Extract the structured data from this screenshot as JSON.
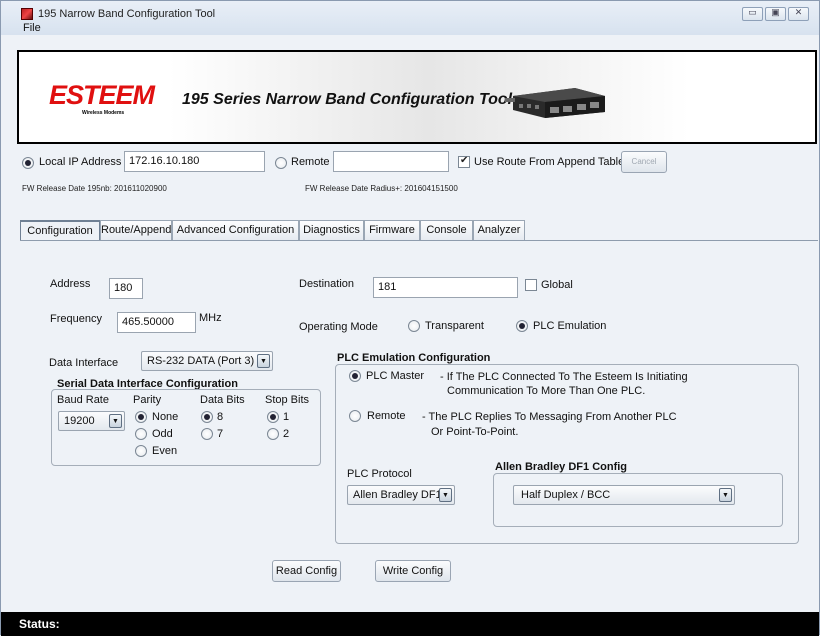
{
  "window": {
    "title": "195 Narrow Band Configuration Tool",
    "menu_file": "File",
    "minimize_glyph": "▭",
    "maximize_glyph": "▣",
    "close_glyph": "✕"
  },
  "banner": {
    "logo": "ESTEEM",
    "logo_sub": "Wireless Modems",
    "title": "195 Series Narrow Band Configuration Tool"
  },
  "connection": {
    "local_label": "Local IP Address",
    "local_ip": "172.16.10.180",
    "local_selected": true,
    "remote_label": "Remote",
    "remote_value": "",
    "remote_selected": false,
    "use_route_label": "Use Route From Append Table",
    "use_route_checked": true,
    "cancel_label": "Cancel",
    "fw_local": "FW Release Date 195nb: 201611020900",
    "fw_radius": "FW Release Date Radius+: 201604151500"
  },
  "tabs": [
    {
      "label": "Configuration",
      "active": true
    },
    {
      "label": "Route/Append",
      "active": false
    },
    {
      "label": "Advanced Configuration",
      "active": false
    },
    {
      "label": "Diagnostics",
      "active": false
    },
    {
      "label": "Firmware",
      "active": false
    },
    {
      "label": "Console",
      "active": false
    },
    {
      "label": "Analyzer",
      "active": false
    }
  ],
  "config": {
    "address_label": "Address",
    "address_value": "180",
    "destination_label": "Destination",
    "destination_value": "181",
    "global_label": "Global",
    "global_checked": false,
    "frequency_label": "Frequency",
    "frequency_value": "465.50000",
    "frequency_unit": "MHz",
    "operating_mode_label": "Operating Mode",
    "mode_transparent": "Transparent",
    "mode_plc": "PLC Emulation",
    "mode_selected": "PLC Emulation",
    "data_interface_label": "Data Interface",
    "data_interface_value": "RS-232 DATA (Port 3)"
  },
  "serial": {
    "title": "Serial Data Interface Configuration",
    "baud_label": "Baud Rate",
    "baud_value": "19200",
    "parity_label": "Parity",
    "parity_options": [
      "None",
      "Odd",
      "Even"
    ],
    "parity_selected": "None",
    "databits_label": "Data Bits",
    "databits_options": [
      "8",
      "7"
    ],
    "databits_selected": "8",
    "stopbits_label": "Stop Bits",
    "stopbits_options": [
      "1",
      "2"
    ],
    "stopbits_selected": "1"
  },
  "plc": {
    "title": "PLC Emulation Configuration",
    "master_label": "PLC Master",
    "master_desc_1": "- If The PLC Connected To The Esteem Is Initiating",
    "master_desc_2": "Communication To More Than One PLC.",
    "remote_label": "Remote",
    "remote_desc_1": "- The PLC Replies To Messaging From Another PLC",
    "remote_desc_2": "Or Point-To-Point.",
    "selected": "PLC Master",
    "protocol_label": "PLC Protocol",
    "protocol_value": "Allen Bradley DF1",
    "df1_title": "Allen Bradley DF1 Config",
    "df1_value": "Half Duplex / BCC"
  },
  "actions": {
    "read_label": "Read Config",
    "write_label": "Write Config"
  },
  "status": {
    "label": "Status:"
  }
}
